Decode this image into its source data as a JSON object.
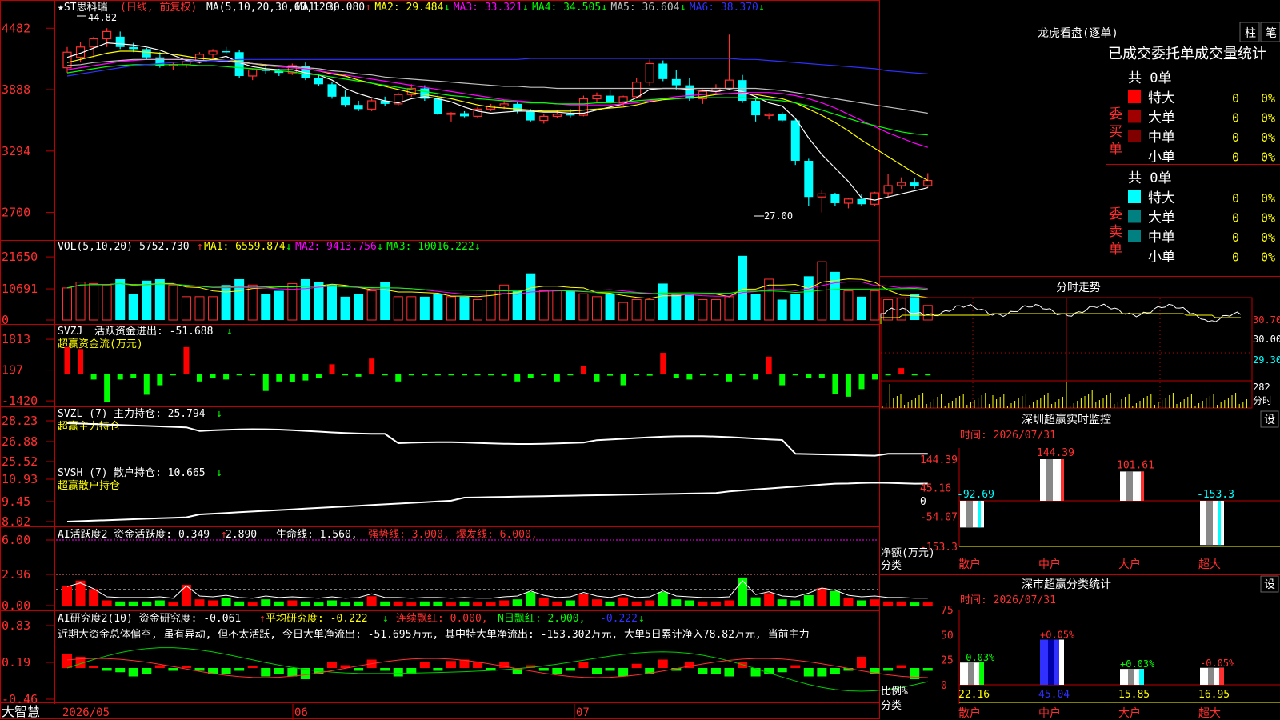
{
  "header": {
    "main": {
      "symbol": "★ST思科瑞",
      "period": "(日线, 前复权)",
      "ma_label": "MA(5,10,20,30,60,120)",
      "ma": [
        {
          "name": "MA1",
          "value": "30.080",
          "arrow": "↑",
          "color": "#ffffff"
        },
        {
          "name": "MA2",
          "value": "29.484",
          "arrow": "↓",
          "color": "#ffff00"
        },
        {
          "name": "MA3",
          "value": "33.321",
          "arrow": "↓",
          "color": "#ff00ff"
        },
        {
          "name": "MA4",
          "value": "34.505",
          "arrow": "↓",
          "color": "#00ff00"
        },
        {
          "name": "MA5",
          "value": "36.604",
          "arrow": "↓",
          "color": "#c0c0c0"
        },
        {
          "name": "MA6",
          "value": "38.370",
          "arrow": "↓",
          "color": "#3030ff"
        }
      ]
    },
    "vol": {
      "label": "VOL(5,10,20)",
      "value": "5752.730",
      "arrow": "↑",
      "ma": [
        {
          "name": "MA1",
          "value": "6559.874",
          "arrow": "↓",
          "color": "#ffff00"
        },
        {
          "name": "MA2",
          "value": "9413.756",
          "arrow": "↓",
          "color": "#ff00ff"
        },
        {
          "name": "MA3",
          "value": "10016.222",
          "arrow": "↓",
          "color": "#00ff00"
        }
      ]
    },
    "svzj": {
      "label": "SVZJ",
      "text": "活跃资金进出: -51.688",
      "arrow": "↓",
      "sub": "超赢资金流(万元)"
    },
    "svzl": {
      "label": "SVZL (7)",
      "text": "主力持仓: 25.794",
      "arrow": "↓",
      "sub": "超赢主力持仓"
    },
    "svsh": {
      "label": "SVSH (7)",
      "text": "散户持仓: 10.665",
      "arrow": "↓",
      "sub": "超赢散户持仓"
    },
    "ai1": {
      "a": "AI活跃度2 资金活跃度: 0.349",
      "a_arrow": "↑",
      "b": "2.890",
      "c": "生命线: 1.560,",
      "d": "强势线: 3.000,",
      "e": "爆发线: 6.000,"
    },
    "ai2": {
      "a": "AI研究度2(10) 资金研究度: -0.061",
      "a_arrow": "↑",
      "b": "平均研究度: -0.222",
      "b_arrow": "↓",
      "c": "连续飘红: 0.000,",
      "d": "N日飘红: 2.000,",
      "e": "-0.222",
      "e_arrow": "↓"
    },
    "comment": "近期大资金总体偏空, 虽有异动, 但不太活跃, 今日大单净流出: -51.695万元, 其中特大单净流出: -153.302万元, 大单5日累计净入78.82万元, 当前主力"
  },
  "price_axis": [
    "4482",
    "3888",
    "3294",
    "2700"
  ],
  "vol_axis": [
    "21650",
    "10691",
    "0"
  ],
  "svzj_axis": [
    "1813",
    "197",
    "-1420"
  ],
  "svzl_axis": [
    "28.23",
    "26.88",
    "25.52"
  ],
  "svsh_axis": [
    "10.93",
    "9.45",
    "8.02"
  ],
  "ai1_axis": [
    "6.00",
    "2.96",
    "0.00"
  ],
  "ai2_axis": [
    "0.83",
    "0.19",
    "-0.46"
  ],
  "date_axis": [
    "2026/05",
    "06",
    "07"
  ],
  "brand": "大智慧",
  "max_label": "44.82",
  "min_label": "27.00",
  "chart_data": {
    "type": "candlestick",
    "price_range": [
      25.5,
      46.0
    ],
    "candles": [
      [
        41,
        43,
        40.5,
        42.5
      ],
      [
        42,
        43.5,
        41.5,
        43
      ],
      [
        43,
        44,
        42,
        43.8
      ],
      [
        43.8,
        44.82,
        43,
        44.5
      ],
      [
        44,
        44.5,
        42.8,
        43
      ],
      [
        43,
        43.4,
        42.5,
        42.8
      ],
      [
        42.8,
        42.9,
        41.8,
        42
      ],
      [
        42,
        42.5,
        41,
        41.2
      ],
      [
        41.2,
        41.5,
        40.8,
        41.3
      ],
      [
        41.3,
        41.8,
        41,
        41.6
      ],
      [
        41.6,
        42.5,
        41.4,
        42.3
      ],
      [
        42.3,
        42.8,
        41.8,
        42.6
      ],
      [
        42.6,
        43,
        42.3,
        42.5
      ],
      [
        42.5,
        42.7,
        40,
        40.2
      ],
      [
        40.2,
        40.9,
        39.8,
        40.8
      ],
      [
        40.8,
        41.2,
        40.4,
        40.7
      ],
      [
        40.7,
        40.9,
        40.2,
        40.5
      ],
      [
        40.5,
        41.4,
        40.3,
        41.2
      ],
      [
        41.2,
        41.5,
        39.8,
        40
      ],
      [
        40,
        40.4,
        39.2,
        39.4
      ],
      [
        39.4,
        39.6,
        38,
        38.2
      ],
      [
        38.2,
        38.8,
        37.2,
        37.4
      ],
      [
        37.4,
        37.8,
        36.8,
        37
      ],
      [
        37,
        38,
        36.8,
        37.8
      ],
      [
        37.8,
        38.2,
        37.3,
        37.5
      ],
      [
        37.5,
        38.6,
        37.3,
        38.4
      ],
      [
        38.4,
        39.4,
        38.2,
        39
      ],
      [
        39,
        39.3,
        37.8,
        38
      ],
      [
        38,
        38.4,
        36.4,
        36.5
      ],
      [
        36.5,
        36.7,
        35.8,
        36.6
      ],
      [
        36.6,
        36.8,
        36.2,
        36.3
      ],
      [
        36.3,
        37.2,
        36.1,
        37
      ],
      [
        37,
        37.5,
        36.8,
        37.3
      ],
      [
        37.3,
        37.9,
        37,
        37.5
      ],
      [
        37.5,
        37.7,
        36.6,
        36.8
      ],
      [
        36.8,
        37,
        35.8,
        35.9
      ],
      [
        35.9,
        36.5,
        35.6,
        36.3
      ],
      [
        36.3,
        36.9,
        36.1,
        36.5
      ],
      [
        36.5,
        37,
        36.2,
        36.4
      ],
      [
        36.4,
        38.3,
        36.3,
        38
      ],
      [
        38,
        38.6,
        37.6,
        38.3
      ],
      [
        38.3,
        38.8,
        37.5,
        37.6
      ],
      [
        37.6,
        38.3,
        37.3,
        38.2
      ],
      [
        38.2,
        40,
        38,
        39.6
      ],
      [
        39.6,
        41.8,
        39.2,
        41.4
      ],
      [
        41.4,
        41.7,
        39.7,
        39.9
      ],
      [
        39.9,
        40.8,
        38.9,
        39.3
      ],
      [
        39.3,
        40,
        37.8,
        38
      ],
      [
        38,
        38.9,
        37.5,
        38.7
      ],
      [
        38.7,
        39.4,
        38.4,
        39
      ],
      [
        39,
        44.2,
        38.8,
        39.8
      ],
      [
        39.8,
        40.3,
        37.6,
        37.8
      ],
      [
        37.8,
        38,
        35.8,
        36.4
      ],
      [
        36.4,
        36.6,
        36,
        36.5
      ],
      [
        36.5,
        36.7,
        35.8,
        35.9
      ],
      [
        35.9,
        36.1,
        31.6,
        32
      ],
      [
        32,
        32.2,
        27.6,
        28.5
      ],
      [
        28.5,
        29.2,
        27,
        28.8
      ],
      [
        28.8,
        28.9,
        27.6,
        27.9
      ],
      [
        27.9,
        28.4,
        27.4,
        28.3
      ],
      [
        28.3,
        28.8,
        27.6,
        27.8
      ],
      [
        27.8,
        29,
        27.6,
        28.9
      ],
      [
        28.9,
        30.7,
        28.5,
        29.6
      ],
      [
        29.6,
        30.4,
        29.3,
        29.9
      ],
      [
        29.9,
        30.3,
        29.3,
        29.6
      ],
      [
        29.6,
        30.8,
        29.4,
        30.1
      ]
    ],
    "ma_series": [
      {
        "name": "MA1",
        "color": "#ffffff",
        "values": [
          42,
          42.4,
          42.9,
          43.4,
          43.3,
          43.2,
          43,
          42.7,
          42.2,
          41.7,
          41.5,
          41.8,
          42.1,
          41.5,
          41.1,
          40.9,
          40.8,
          40.8,
          40.5,
          40.3,
          39.8,
          39,
          38.5,
          38.1,
          37.8,
          37.6,
          38,
          38.2,
          38,
          37.7,
          37.2,
          36.8,
          36.6,
          36.7,
          36.8,
          36.8,
          36.7,
          36.7,
          36.6,
          36.6,
          36.9,
          37.2,
          37.5,
          38.1,
          38.9,
          39,
          39,
          38.9,
          38.8,
          38.7,
          38.9,
          38.7,
          38.2,
          37.6,
          37.3,
          36.1,
          34.2,
          32.6,
          31.3,
          30,
          28.4,
          28.2,
          28.5,
          28.8,
          29.1,
          29.4
        ]
      },
      {
        "name": "MA2",
        "color": "#ffff00",
        "values": [
          41.5,
          41.8,
          42.1,
          42.4,
          42.6,
          42.6,
          42.5,
          42.4,
          42.3,
          42.1,
          41.9,
          41.8,
          41.7,
          41.6,
          41.4,
          41.2,
          41.1,
          41,
          40.9,
          40.7,
          40.4,
          40.2,
          39.8,
          39.5,
          39.2,
          38.9,
          38.6,
          38.4,
          38.2,
          38,
          37.7,
          37.4,
          37.2,
          37.1,
          37,
          36.9,
          36.8,
          36.8,
          36.8,
          36.9,
          37,
          37.1,
          37.2,
          37.4,
          37.7,
          37.9,
          38,
          38.1,
          38.2,
          38.4,
          38.5,
          38.5,
          38.4,
          38.2,
          38,
          37.6,
          37,
          36.4,
          35.7,
          34.9,
          34,
          33.2,
          32.4,
          31.6,
          30.8,
          30.1
        ]
      },
      {
        "name": "MA3",
        "color": "#ff00ff",
        "values": [
          40.8,
          41,
          41.2,
          41.4,
          41.6,
          41.7,
          41.8,
          41.8,
          41.8,
          41.8,
          41.7,
          41.7,
          41.6,
          41.5,
          41.4,
          41.3,
          41.1,
          41,
          40.9,
          40.7,
          40.5,
          40.3,
          40.1,
          39.9,
          39.7,
          39.5,
          39.3,
          39.1,
          38.9,
          38.7,
          38.5,
          38.3,
          38.1,
          37.9,
          37.8,
          37.7,
          37.6,
          37.5,
          37.4,
          37.4,
          37.4,
          37.4,
          37.5,
          37.6,
          37.8,
          38,
          38.2,
          38.3,
          38.4,
          38.5,
          38.5,
          38.6,
          38.6,
          38.6,
          38.5,
          38.3,
          38,
          37.6,
          37.1,
          36.5,
          35.9,
          35.3,
          34.7,
          34.2,
          33.7,
          33.3
        ]
      },
      {
        "name": "MA4",
        "color": "#00ff00",
        "values": [
          40.5,
          40.7,
          40.9,
          41.1,
          41.2,
          41.3,
          41.3,
          41.3,
          41.3,
          41.3,
          41.2,
          41.2,
          41.1,
          41,
          40.9,
          40.8,
          40.7,
          40.6,
          40.4,
          40.3,
          40.1,
          39.9,
          39.7,
          39.5,
          39.3,
          39.1,
          38.9,
          38.7,
          38.5,
          38.3,
          38.2,
          38,
          37.9,
          37.8,
          37.7,
          37.6,
          37.6,
          37.5,
          37.5,
          37.5,
          37.6,
          37.6,
          37.7,
          37.8,
          37.9,
          38,
          38,
          38.1,
          38.1,
          38.1,
          38.1,
          38.1,
          38,
          37.9,
          37.8,
          37.6,
          37.3,
          36.9,
          36.5,
          36.1,
          35.7,
          35.4,
          35.1,
          34.8,
          34.6,
          34.5
        ]
      },
      {
        "name": "MA5",
        "color": "#c0c0c0",
        "values": [
          41.2,
          41.3,
          41.5,
          41.6,
          41.7,
          41.8,
          41.8,
          41.8,
          41.8,
          41.8,
          41.7,
          41.7,
          41.6,
          41.5,
          41.4,
          41.3,
          41.2,
          41.1,
          41,
          40.9,
          40.7,
          40.6,
          40.4,
          40.3,
          40.1,
          40,
          39.9,
          39.8,
          39.7,
          39.6,
          39.5,
          39.4,
          39.3,
          39.2,
          39.2,
          39.1,
          39.1,
          39,
          39,
          39,
          39,
          39,
          39,
          39,
          39,
          39,
          39,
          39,
          39,
          39,
          39,
          39,
          39,
          38.9,
          38.8,
          38.6,
          38.4,
          38.2,
          38,
          37.8,
          37.6,
          37.4,
          37.2,
          37,
          36.8,
          36.6
        ]
      },
      {
        "name": "MA6",
        "color": "#3030ff",
        "values": [
          40.2,
          40.4,
          40.6,
          40.8,
          41,
          41.2,
          41.3,
          41.4,
          41.5,
          41.6,
          41.6,
          41.7,
          41.7,
          41.8,
          41.8,
          41.8,
          41.8,
          41.8,
          41.8,
          41.8,
          41.8,
          41.8,
          41.8,
          41.8,
          41.8,
          41.8,
          41.8,
          41.8,
          41.8,
          41.8,
          41.8,
          41.8,
          41.8,
          41.8,
          41.8,
          41.9,
          41.9,
          41.9,
          41.9,
          41.9,
          41.9,
          41.9,
          41.9,
          41.9,
          41.9,
          41.9,
          41.9,
          41.9,
          41.9,
          41.9,
          41.9,
          41.8,
          41.8,
          41.7,
          41.6,
          41.5,
          41.4,
          41.3,
          41.2,
          41.1,
          41,
          40.9,
          40.7,
          40.6,
          40.5,
          40.4
        ]
      }
    ],
    "volume": [
      11000,
      13000,
      12500,
      12000,
      14000,
      9000,
      13500,
      14000,
      12000,
      8000,
      8000,
      8000,
      12000,
      14000,
      12000,
      9000,
      10000,
      12500,
      14000,
      13000,
      12000,
      8000,
      9000,
      10000,
      13000,
      8000,
      8000,
      8000,
      9000,
      8000,
      8000,
      7000,
      10000,
      12000,
      10000,
      16000,
      10000,
      10000,
      10000,
      9000,
      8000,
      9000,
      6000,
      7000,
      7000,
      12500,
      9000,
      9000,
      7000,
      7000,
      8000,
      22000,
      9000,
      14000,
      7000,
      9000,
      15000,
      20000,
      16500,
      10000,
      8000,
      10000,
      7000,
      7500,
      9000,
      5000
    ],
    "svzj": [
      1400,
      1300,
      -300,
      -1500,
      -300,
      -200,
      -1100,
      -600,
      -50,
      1400,
      -400,
      -200,
      -300,
      -50,
      -50,
      -900,
      -400,
      -450,
      -350,
      -200,
      500,
      -50,
      -150,
      800,
      -50,
      -400,
      -50,
      -50,
      -50,
      -50,
      -50,
      -50,
      -50,
      -100,
      -400,
      -200,
      -50,
      -400,
      -50,
      400,
      -400,
      -100,
      -600,
      -50,
      -100,
      1100,
      -200,
      -300,
      -50,
      -50,
      -400,
      -50,
      -300,
      900,
      -600,
      -50,
      -200,
      -200,
      -1050,
      -1200,
      -800,
      -300,
      -50,
      300,
      -50,
      -50,
      -50,
      -50
    ]
  },
  "panel_title": "龙虎看盘(逐单)",
  "tabs": [
    "柱",
    "笔"
  ],
  "stats_title": "已成交委托单成交量统计",
  "buy_group": {
    "label": "委买单",
    "total": "共 0单",
    "rows": [
      {
        "name": "特大",
        "color": "#ff0000",
        "count": "0",
        "pct": "0%"
      },
      {
        "name": "大单",
        "color": "#a00000",
        "count": "0",
        "pct": "0%"
      },
      {
        "name": "中单",
        "color": "#800000",
        "count": "0",
        "pct": "0%"
      },
      {
        "name": "小单",
        "color": "",
        "count": "0",
        "pct": "0%"
      }
    ]
  },
  "sell_group": {
    "label": "委卖单",
    "total": "共 0单",
    "rows": [
      {
        "name": "特大",
        "color": "#00ffff",
        "count": "0",
        "pct": "0%"
      },
      {
        "name": "大单",
        "color": "#008080",
        "count": "0",
        "pct": "0%"
      },
      {
        "name": "中单",
        "color": "#008080",
        "count": "0",
        "pct": "0%"
      },
      {
        "name": "小单",
        "color": "",
        "count": "0",
        "pct": "0%"
      }
    ]
  },
  "intraday": {
    "title": "分时走势",
    "axis": [
      "30.70",
      "30.00",
      "29.30"
    ],
    "vol_label": "282",
    "vol_unit": "分时"
  },
  "monitor": {
    "title": "深圳超赢实时监控",
    "set": "设",
    "time": "时间: 2026/07/31",
    "axis": [
      "144.39",
      "45.16",
      "0",
      "-54.07",
      "-153.3"
    ],
    "unit": "净额(万元)",
    "cat_label": "分类",
    "categories": [
      "散户",
      "中户",
      "大户",
      "超大"
    ],
    "values": [
      -92.69,
      144.39,
      101.61,
      -153.3
    ],
    "labels": [
      "-92.69",
      "144.39",
      "101.61",
      "-153.3"
    ]
  },
  "classify": {
    "title": "深市超赢分类统计",
    "set": "设",
    "time": "时间: 2026/07/31",
    "axis": [
      "75",
      "50",
      "25",
      "0"
    ],
    "unit": "比例%",
    "cat_label": "分类",
    "categories": [
      "散户",
      "中户",
      "大户",
      "超大"
    ],
    "values": [
      22.16,
      45.04,
      15.85,
      16.95
    ],
    "labels": [
      "22.16",
      "45.04",
      "15.85",
      "16.95"
    ],
    "changes": [
      "-0.03%",
      "+0.05%",
      "+0.03%",
      "-0.05%"
    ]
  }
}
